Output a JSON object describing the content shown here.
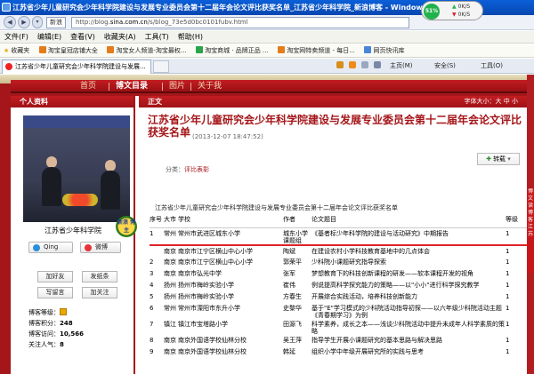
{
  "window": {
    "title": "江苏省少年儿童研究会少年科学院建设与发展专业委员会第十二届年会论文评比获奖名单_江苏省少年科学院_新浪博客 - Windows Internet Ex..."
  },
  "net_meter": {
    "percent": "51%",
    "up": "0K/S",
    "down": "0K/S"
  },
  "address": {
    "tag": "新浪",
    "url_prefix": "http://blog.",
    "url_domain": "sina.com.cn",
    "url_suffix": "/s/blog_73e5d0bc0101fubv.html"
  },
  "menu": [
    "文件(F)",
    "编辑(E)",
    "查看(V)",
    "收藏夹(A)",
    "工具(T)",
    "帮助(H)"
  ],
  "favorites": {
    "label": "收藏夹",
    "items": [
      "淘宝皇冠店铺大全",
      "淘宝女人频道-淘宝最权...",
      "淘宝商城 · 品牌正品 ...",
      "淘宝网特卖频道 - 每日...",
      "网页快讯库"
    ]
  },
  "tabs": {
    "active": "江苏省少年儿童研究会少年科学院建设与发展...",
    "tools": [
      "主页(M)",
      "安全(S)",
      "工具(O)"
    ]
  },
  "blog_nav": [
    "首页",
    "博文目录",
    "图片",
    "关于我"
  ],
  "sidebar": {
    "header": "个人资料",
    "badge_text": "新浪 博主",
    "blogger_name": "江苏省少年科学院",
    "qing": "Qing",
    "weibo": "微博",
    "buttons": [
      "加好友",
      "发纸条",
      "写留言",
      "加关注"
    ],
    "stats": [
      {
        "label": "博客等级：",
        "value": ""
      },
      {
        "label": "博客积分：",
        "value": "248"
      },
      {
        "label": "博客访问：",
        "value": "10,566"
      },
      {
        "label": "关注人气：",
        "value": "8"
      }
    ]
  },
  "main": {
    "header": "正文",
    "font_size_label": "字体大小：大 中 小",
    "title": "江苏省少年儿童研究会少年科学院建设与发展专业委员会第十二届年会论文评比获奖名单",
    "date": "(2013-12-07 18:47:52)",
    "share": "转载",
    "category_label": "分类：",
    "category_value": "评比表彰",
    "intro": "江苏省少年儿童研究会少年科学院建设与发展专业委员会第十二届年会论文评比获奖名单",
    "table": {
      "headers": [
        "序号",
        "大市",
        "学校",
        "作者",
        "论文题目",
        "等级"
      ],
      "rows": [
        [
          "1",
          "常州",
          "常州市武进区城东小学",
          "城东小学 课题组",
          "《基者标少年科学院的建设与活动研究》中期报告",
          "1"
        ],
        [
          "",
          "南京",
          "南京市江宁区横山中心小学",
          "陶斌",
          "在建设农村小学科技教育基地中的几点体会",
          "1"
        ],
        [
          "2",
          "南京",
          "南京市江宁区横山中心小学",
          "郭荣平",
          "少科院小课题研究指导探索",
          "1"
        ],
        [
          "3",
          "南京",
          "南京市弘光中学",
          "张军",
          "梦想教育下的科技创新课程的研发——软本课程开发的视角",
          "1"
        ],
        [
          "4",
          "扬州",
          "扬州市梅岭实验小学",
          "崔伟",
          "例说提高科学探究能力的策略——以\"小小\"进行科学探究教学",
          "1"
        ],
        [
          "5",
          "扬州",
          "扬州市梅岭实验小学",
          "方春生",
          "开展综合实践活动，培养科技创新能力",
          "1"
        ],
        [
          "6",
          "常州",
          "常州市溧阳市东升小学",
          "史黎华",
          "基于\"E\"学习模式的少科院活动指导初探——以六年级少科院活动主题《青春期学习》为例",
          "1"
        ],
        [
          "7",
          "镇江",
          "镇江市宝塔路小学",
          "田源飞",
          "科学素养，成长之本——浅谈少科院活动中提升未成年人科学素质的策略",
          "1"
        ],
        [
          "8",
          "南京",
          "南京外国语学校仙林分校",
          "吴王萍",
          "指导学生开展小课题研究的基本思路与解决思路",
          "1"
        ],
        [
          "9",
          "南京",
          "南京外国语学校仙林分校",
          "韩延",
          "组织小学中年级开展研究所的实践与思考",
          "1"
        ]
      ]
    }
  },
  "right_badge": "博文 读 博客 江苏"
}
